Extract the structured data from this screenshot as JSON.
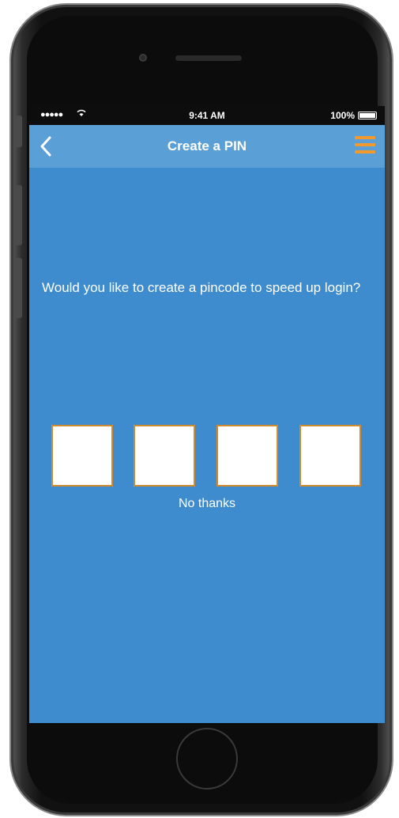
{
  "status_bar": {
    "signal": "●●●●●",
    "time": "9:41 AM",
    "battery_percent": "100%"
  },
  "nav": {
    "title": "Create a PIN",
    "back_icon": "chevron-left-icon",
    "menu_icon": "hamburger-menu-icon",
    "menu_color": "#f39a2c"
  },
  "content": {
    "prompt": "Would you like to create a pincode to speed up login?",
    "pin_fields": [
      "",
      "",
      "",
      ""
    ],
    "skip_link": "No thanks"
  },
  "colors": {
    "screen_bg": "#3e8ccd",
    "nav_bg": "#5a9fd6",
    "pin_border": "#d28a2e"
  }
}
